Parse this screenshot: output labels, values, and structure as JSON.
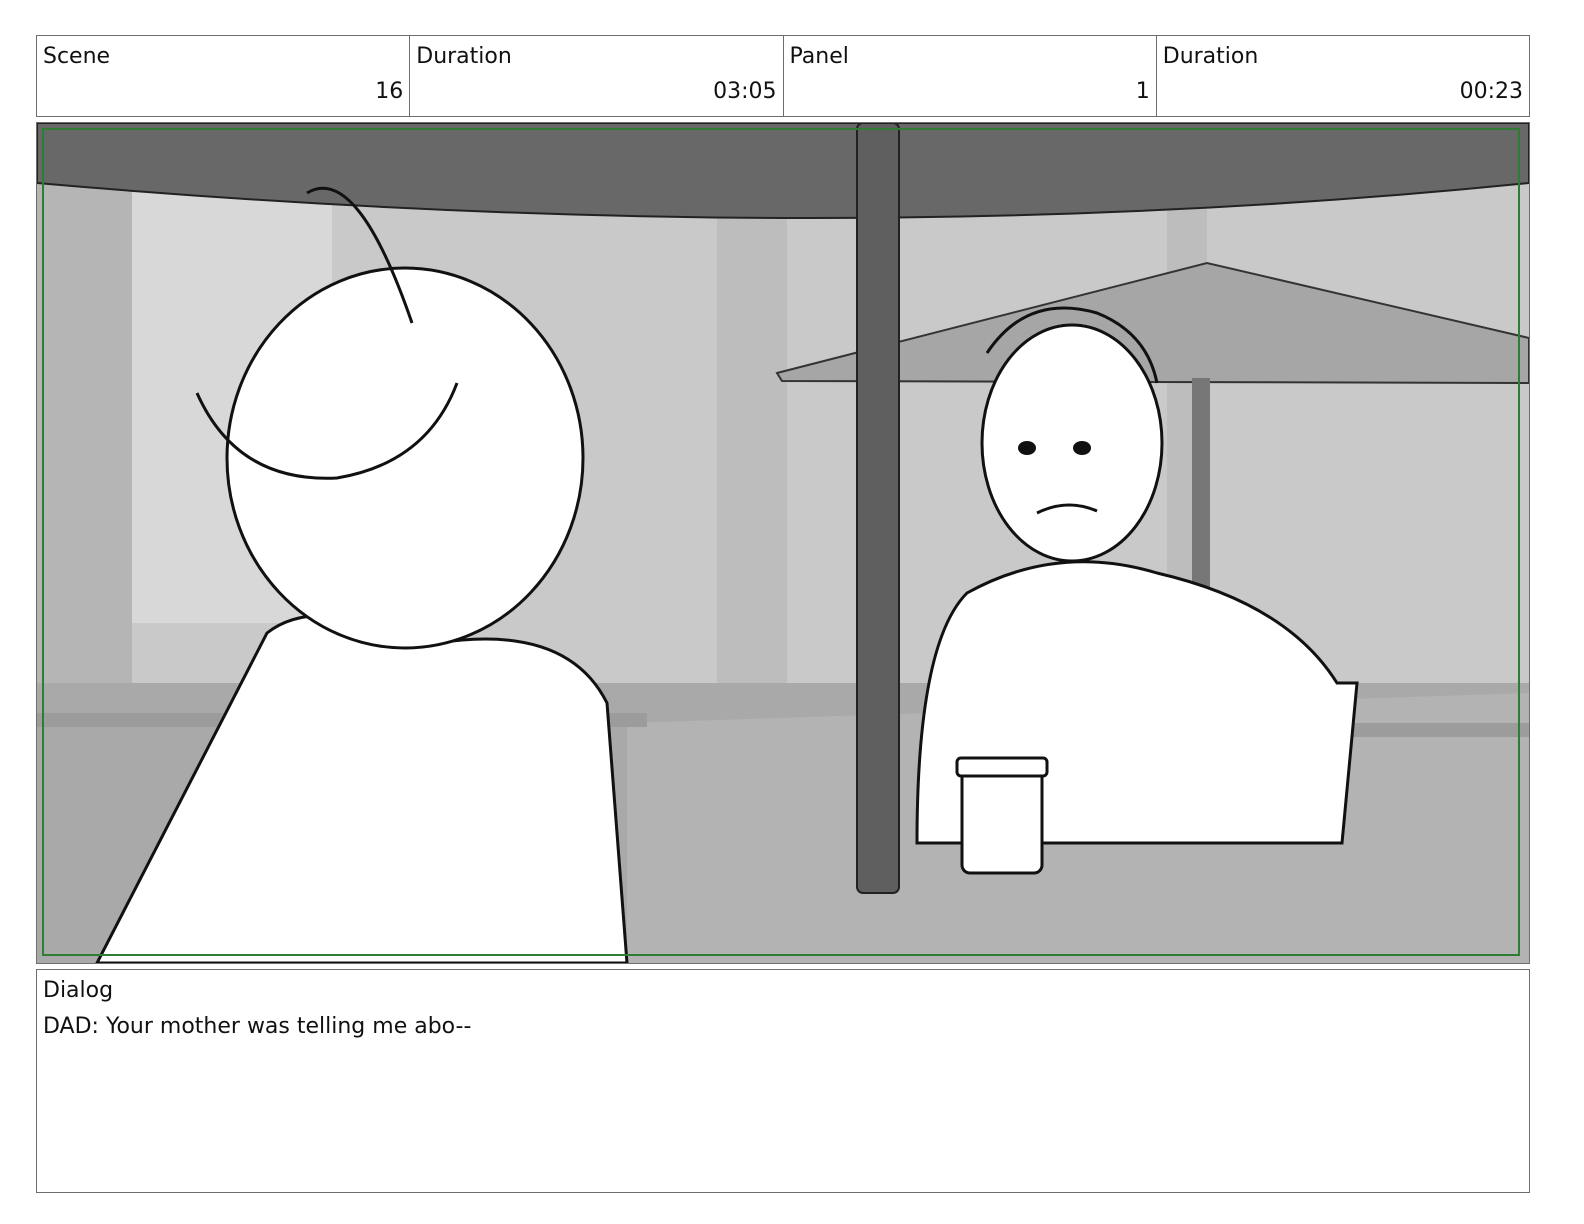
{
  "header": {
    "scene": {
      "label": "Scene",
      "value": "16"
    },
    "scene_duration": {
      "label": "Duration",
      "value": "03:05"
    },
    "panel": {
      "label": "Panel",
      "value": "1"
    },
    "panel_duration": {
      "label": "Duration",
      "value": "00:23"
    }
  },
  "dialog": {
    "label": "Dialog",
    "text": "DAD: Your mother was telling me abo--"
  },
  "colors": {
    "frame_border": "#2e7d32",
    "table_border": "#6e6e6e"
  }
}
